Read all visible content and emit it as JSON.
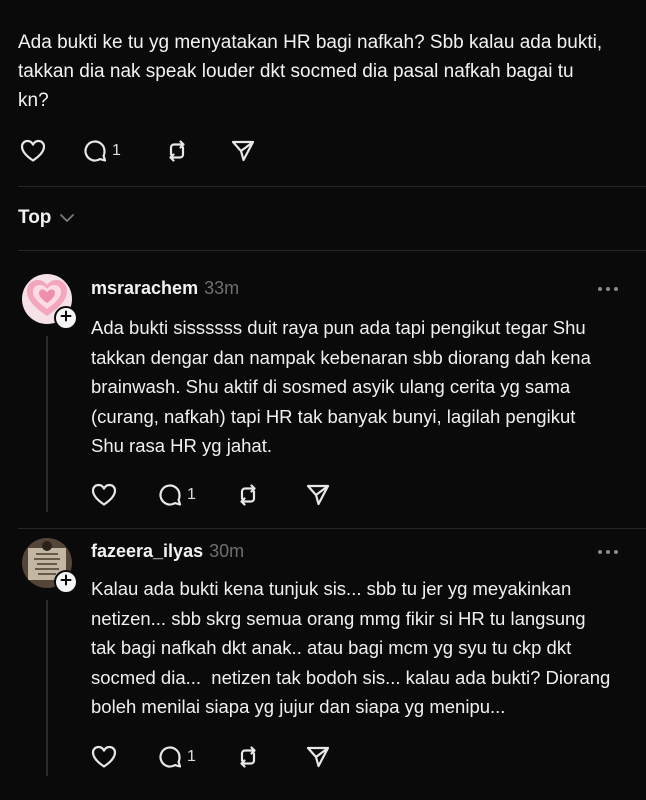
{
  "post": {
    "text": "Ada bukti ke tu yg menyatakan HR bagi nafkah? Sbb kalau ada bukti,\ntakkan dia nak speak louder dkt socmed dia pasal nafkah bagai tu\nkn?",
    "reply_count": "1",
    "icons": [
      "heart-icon",
      "comment-icon",
      "repost-icon",
      "share-icon"
    ]
  },
  "sort": {
    "label": "Top",
    "icon": "chevron-down-icon"
  },
  "replies": [
    {
      "username": "msrarachem",
      "time": "33m",
      "text": "Ada bukti sissssss duit raya pun ada tapi pengikut tegar Shu\ntakkan dengar dan nampak kebenaran sbb diorang dah kena\nbrainwash. Shu aktif di sosmed asyik ulang cerita yg sama\n(curang, nafkah) tapi HR tak banyak bunyi, lagilah pengikut\nShu rasa HR yg jahat.",
      "reply_count": "1"
    },
    {
      "username": "fazeera_ilyas",
      "time": "30m",
      "text": "Kalau ada bukti kena tunjuk sis... sbb tu jer yg meyakinkan\nnetizen... sbb skrg semua orang mmg fikir si HR tu langsung\ntak bagi nafkah dkt anak.. atau bagi mcm yg syu tu ckp dkt\nsocmed dia...  netizen tak bodoh sis... kalau ada bukti? Diorang\nboleh menilai siapa yg jujur dan siapa yg menipu...",
      "reply_count": "1"
    }
  ],
  "colors": {
    "background": "#0a0a0a",
    "text": "#f1f1f1",
    "muted": "#6f6f6f",
    "divider": "#262626"
  }
}
